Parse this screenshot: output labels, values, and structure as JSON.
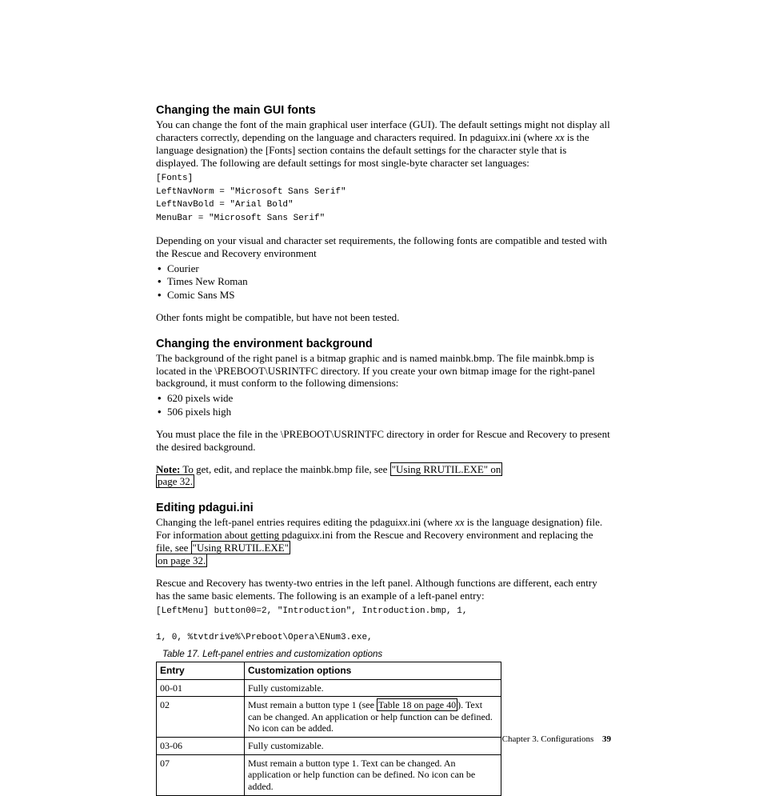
{
  "sections": {
    "fonts": {
      "heading": "Changing the main GUI fonts",
      "p1_a": "You can change the font of the main graphical user interface (GUI). The default settings might not display all characters correctly, depending on the language and characters required. In pdagui",
      "p1_xx": "xx",
      "p1_b": ".ini (where ",
      "p1_xx2": "xx",
      "p1_c": " is the language designation) the [Fonts] section contains the default settings for the character style that is displayed. The following are default settings for most single-byte character set languages:",
      "code": "[Fonts]\nLeftNavNorm = \"Microsoft Sans Serif\"\nLeftNavBold = \"Arial Bold\"\nMenuBar = \"Microsoft Sans Serif\"",
      "p2": "Depending on your visual and character set requirements, the following fonts are compatible and tested with the Rescue and Recovery environment",
      "bullets": [
        "Courier",
        "Times New Roman",
        "Comic Sans MS"
      ],
      "p3": "Other fonts might be compatible, but have not been tested."
    },
    "bg": {
      "heading": "Changing the environment background",
      "p1": "The background of the right panel is a bitmap graphic and is named mainbk.bmp. The file mainbk.bmp is located in the \\PREBOOT\\USRINTFC directory. If you create your own bitmap image for the right-panel background, it must conform to the following dimensions:",
      "bullets": [
        "620 pixels wide",
        "506 pixels high"
      ],
      "p2": "You must place the file in the \\PREBOOT\\USRINTFC directory in order for Rescue and Recovery to present the desired background.",
      "note_label": "Note:",
      "note_a": " To get, edit, and replace the mainbk.bmp file, see ",
      "note_link1": "\"Using RRUTIL.EXE\" on",
      "note_link2": "page 32."
    },
    "edit": {
      "heading": "Editing pdagui.ini",
      "p1_a": "Changing the left-panel entries requires editing the pdagui",
      "p1_xx": "xx",
      "p1_b": ".ini (where ",
      "p1_xx2": "xx",
      "p1_c": " is the language designation) file. For information about getting pdagui",
      "p1_xx3": "xx",
      "p1_d": ".ini from the Rescue and Recovery environment and replacing the file, see ",
      "p1_link1": "\"Using RRUTIL.EXE\"",
      "p1_link2": "on page 32.",
      "p2": "Rescue and Recovery has twenty-two entries in the left panel. Although functions are different, each entry has the same basic elements. The following is an example of a left-panel entry:",
      "code": "[LeftMenu] button00=2, \"Introduction\", Introduction.bmp, 1,\n\n1, 0, %tvtdrive%\\Preboot\\Opera\\ENum3.exe,"
    }
  },
  "table": {
    "caption": "Table 17. Left-panel entries and customization options",
    "headers": [
      "Entry",
      "Customization options"
    ],
    "rows": [
      {
        "entry": "00-01",
        "opts_a": "Fully customizable."
      },
      {
        "entry": "02",
        "opts_a": "Must remain a button type 1 (see ",
        "opts_link": "Table 18 on page 40",
        "opts_b": "). Text can be changed. An application or help function can be defined. No icon can be added."
      },
      {
        "entry": "03-06",
        "opts_a": "Fully customizable."
      },
      {
        "entry": "07",
        "opts_a": "Must remain a button type 1. Text can be changed. An application or help function can be defined. No icon can be added."
      }
    ]
  },
  "footer": {
    "chapter": "Chapter 3. Configurations",
    "page": "39"
  }
}
